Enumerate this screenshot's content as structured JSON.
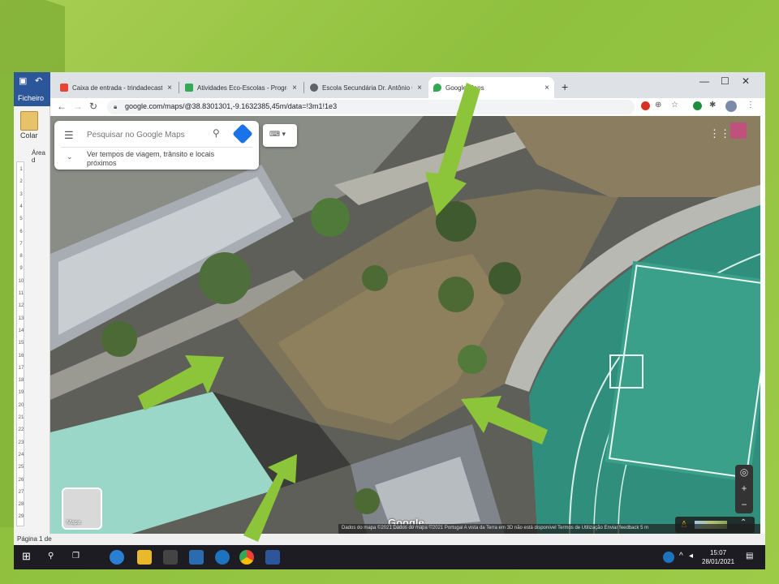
{
  "word": {
    "file_label": "Ficheiro",
    "paste_label": "Colar",
    "clipboard_area": "Área d",
    "status": "Página 1 de",
    "ruler_numbers": [
      "1",
      "2",
      "3",
      "4",
      "5",
      "6",
      "7",
      "8",
      "9",
      "10",
      "11",
      "12",
      "13",
      "14",
      "15",
      "16",
      "17",
      "18",
      "19",
      "20",
      "21",
      "22",
      "23",
      "24",
      "25",
      "26",
      "27",
      "28",
      "29"
    ]
  },
  "chrome": {
    "tabs": [
      {
        "title": "Caixa de entrada - trindadecastro",
        "icon_color": "#ea4335",
        "active": false
      },
      {
        "title": "Atividades Eco-Escolas - Programa",
        "icon_color": "#34a853",
        "active": false
      },
      {
        "title": "Escola Secundária Dr. Antônio Ca",
        "icon_color": "#5f6368",
        "active": false
      },
      {
        "title": "Google Maps",
        "icon_color": "#34a853",
        "active": true
      }
    ],
    "url": "google.com/maps/@38.8301301,-9.1632385,45m/data=!3m1!1e3",
    "close_glyph": "×",
    "new_tab": "+"
  },
  "map": {
    "search_placeholder": "Pesquisar no Google Maps",
    "travel_text": "Ver tempos de viagem, trânsito e locais próximos",
    "layer_label": "Mapa",
    "logo": "Google",
    "footer": "Dados do mapa ©2021  Dados do mapa ©2021   Portugal   A vista da Terra em 3D não está disponível   Termos de Utilização   Enviar feedback   5 m",
    "icons": [
      "menu-icon",
      "search-icon",
      "directions-icon",
      "keyboard-icon",
      "apps-icon",
      "zoom-in-icon",
      "zoom-out-icon",
      "compass-icon",
      "pegman-icon"
    ]
  },
  "taskbar": {
    "time": "15:07",
    "date": "28/01/2021"
  },
  "colors": {
    "arrow": "#8cc43a",
    "field": "#3aa08a",
    "slide_bg": "#9ccb48"
  }
}
